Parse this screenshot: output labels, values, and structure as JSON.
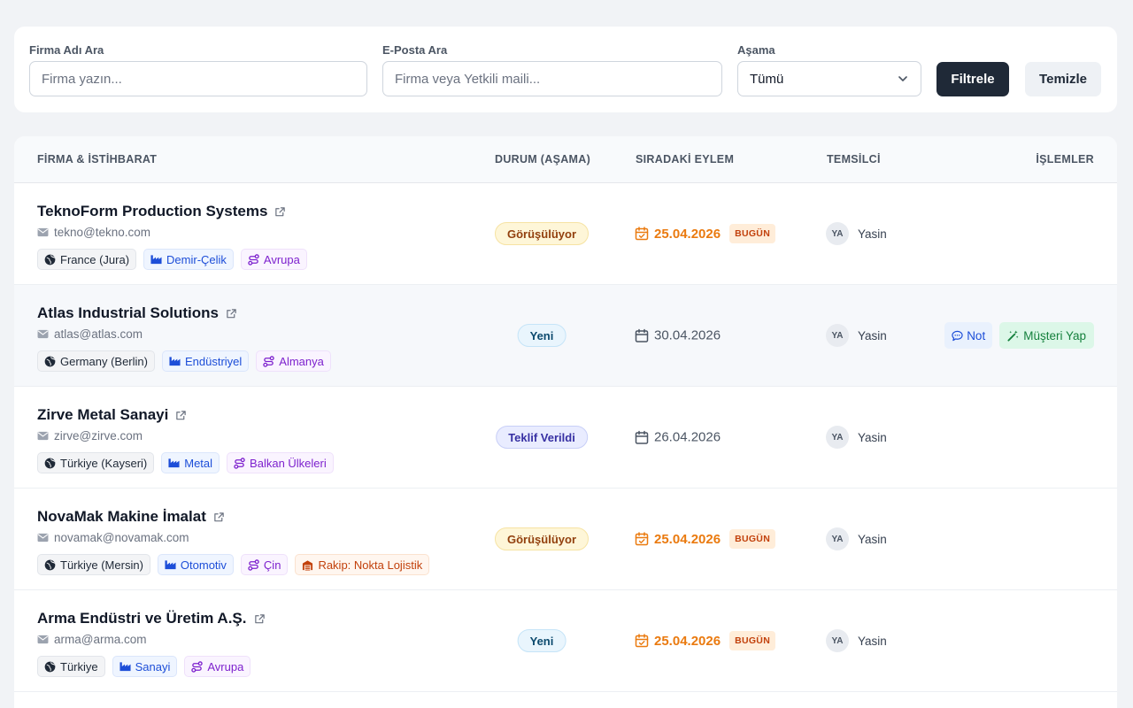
{
  "filters": {
    "company": {
      "label": "Firma Adı Ara",
      "placeholder": "Firma yazın..."
    },
    "email": {
      "label": "E-Posta Ara",
      "placeholder": "Firma veya Yetkili maili..."
    },
    "stage": {
      "label": "Aşama",
      "value": "Tümü"
    },
    "filter_button": "Filtrele",
    "clear_button": "Temizle"
  },
  "table": {
    "headers": {
      "company": "FİRMA & İSTİHBARAT",
      "status": "DURUM (AŞAMA)",
      "next_action": "SIRADAKİ EYLEM",
      "rep": "TEMSİLCİ",
      "ops": "İŞLEMLER"
    },
    "today_badge": "BUGÜN",
    "note_button": "Not",
    "make_customer_button": "Müşteri Yap",
    "rows": [
      {
        "name": "TeknoForm Production Systems",
        "email": "tekno@tekno.com",
        "location": "France (Jura)",
        "sector": "Demir-Çelik",
        "region": "Avrupa",
        "status": "Görüşülüyor",
        "date": "25.04.2026",
        "rep_initials": "YA",
        "rep_name": "Yasin"
      },
      {
        "name": "Atlas Industrial Solutions",
        "email": "atlas@atlas.com",
        "location": "Germany (Berlin)",
        "sector": "Endüstriyel",
        "region": "Almanya",
        "status": "Yeni",
        "date": "30.04.2026",
        "rep_initials": "YA",
        "rep_name": "Yasin"
      },
      {
        "name": "Zirve Metal Sanayi",
        "email": "zirve@zirve.com",
        "location": "Türkiye (Kayseri)",
        "sector": "Metal",
        "region": "Balkan Ülkeleri",
        "status": "Teklif Verildi",
        "date": "26.04.2026",
        "rep_initials": "YA",
        "rep_name": "Yasin"
      },
      {
        "name": "NovaMak Makine İmalat",
        "email": "novamak@novamak.com",
        "location": "Türkiye (Mersin)",
        "sector": "Otomotiv",
        "region": "Çin",
        "competitor": "Rakip: Nokta Lojistik",
        "status": "Görüşülüyor",
        "date": "25.04.2026",
        "rep_initials": "YA",
        "rep_name": "Yasin"
      },
      {
        "name": "Arma Endüstri ve Üretim A.Ş.",
        "email": "arma@arma.com",
        "location": "Türkiye",
        "sector": "Sanayi",
        "region": "Avrupa",
        "status": "Yeni",
        "date": "25.04.2026",
        "rep_initials": "YA",
        "rep_name": "Yasin"
      }
    ]
  },
  "colors": {
    "primary_button": "#1f2937",
    "today": "#ea7a0f",
    "sector": "#1d4ed8",
    "region": "#7e22ce",
    "competitor": "#c2410c"
  },
  "icons": [
    "external-link-icon",
    "mail-icon",
    "globe-icon",
    "factory-icon",
    "route-icon",
    "warehouse-icon",
    "calendar-icon",
    "calendar-check-icon",
    "chevron-down-icon",
    "chat-icon",
    "magic-wand-icon"
  ]
}
